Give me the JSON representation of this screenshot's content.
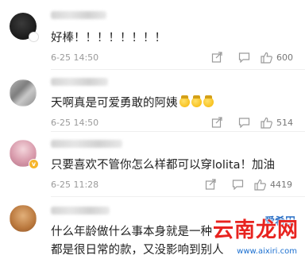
{
  "comments": [
    {
      "text": "好棒！！！！！！！！",
      "time": "6-25 14:50",
      "likes": "600",
      "avatar_color": "#1a1a1a"
    },
    {
      "text": "天啊真是可爱勇敢的阿姨",
      "time": "6-25 14:50",
      "likes": "514",
      "avatar_color": "#9a9a9a"
    },
    {
      "text": "只要喜欢不管你怎么样都可以穿lolita！加油",
      "time": "6-25 11:28",
      "likes": "4419",
      "avatar_color": "#d8a0b0"
    },
    {
      "text_line1": "什么年龄做什么事本身就是一种",
      "text_line2": "都是很日常的款，又没影响到别人",
      "avatar_color": "#c98a4a"
    }
  ],
  "watermark": {
    "brand": "云南龙网",
    "site": "www.aixiri.com",
    "small": "爱希田"
  },
  "colors": {
    "text": "#222222",
    "meta": "#9a9a9a",
    "watermark_red": "#e8231f",
    "watermark_blue": "#1a6fd0"
  }
}
